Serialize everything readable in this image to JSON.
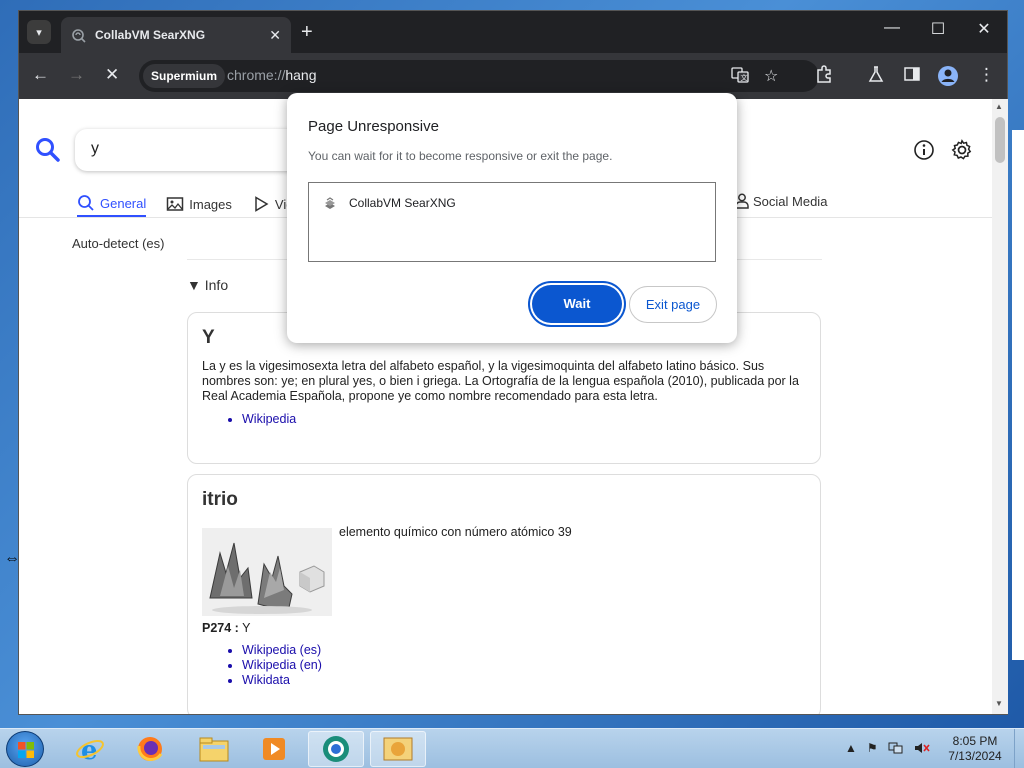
{
  "browser": {
    "tab_title": "CollabVM SearXNG",
    "new_tab_glyph": "+",
    "window_controls": {
      "minimize": "—",
      "maximize": "☐",
      "close": "✕"
    },
    "omnibox": {
      "chip": "Supermium",
      "url_scheme": "chrome://",
      "url_rest": "hang"
    }
  },
  "search": {
    "query": "y",
    "categories": [
      {
        "label": "General",
        "icon": "search-icon",
        "active": true
      },
      {
        "label": "Images",
        "icon": "image-icon"
      },
      {
        "label": "Vide",
        "icon": "play-icon"
      }
    ],
    "social_label": "Social Media",
    "autodetect": "Auto-detect (es)",
    "info_label": "Info"
  },
  "results": {
    "card1": {
      "title": "Y",
      "text": "La y es la vigesimosexta letra del alfabeto español, y la vigesimoquinta del alfabeto latino básico. Sus nombres son: ye; en plural yes, o bien i griega. La Ortografía de la lengua española (2010), publicada por la Real Academia Española, propone ye como nombre recomendado para esta letra.",
      "links": [
        "Wikipedia"
      ]
    },
    "card2": {
      "title": "itrio",
      "text": "elemento químico con número atómico 39",
      "prop_label": "P274 :",
      "prop_value": " Y",
      "links": [
        "Wikipedia (es)",
        "Wikipedia (en)",
        "Wikidata"
      ]
    }
  },
  "dialog": {
    "title": "Page Unresponsive",
    "description": "You can wait for it to become responsive or exit the page.",
    "item": "CollabVM SearXNG",
    "wait_label": "Wait",
    "exit_label": "Exit page"
  },
  "taskbar": {
    "time": "8:05 PM",
    "date": "7/13/2024"
  },
  "colors": {
    "accent": "#3050ff",
    "dialog_primary": "#0b57d0",
    "link": "#1a0dab"
  }
}
